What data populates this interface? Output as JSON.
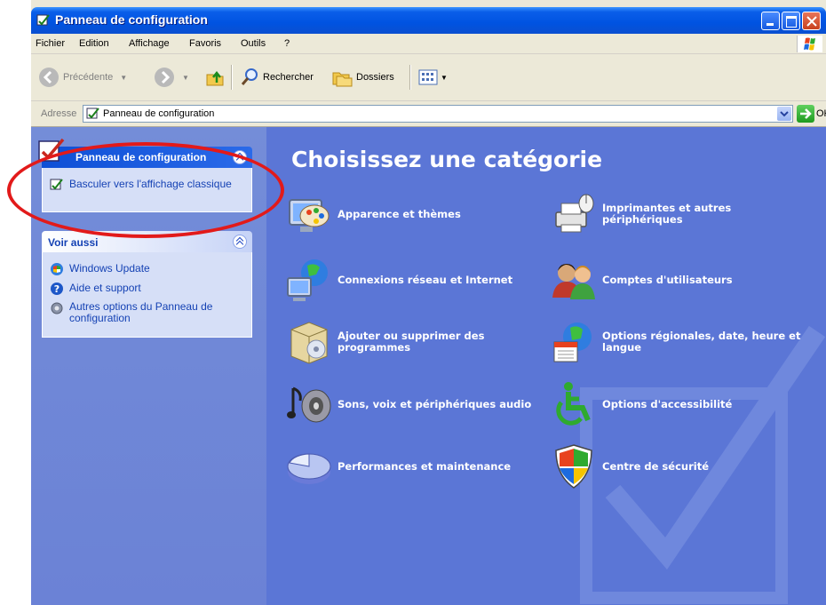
{
  "window": {
    "title": "Panneau de configuration"
  },
  "menubar": {
    "items": [
      "Fichier",
      "Edition",
      "Affichage",
      "Favoris",
      "Outils",
      "?"
    ]
  },
  "toolbar": {
    "back_label": "Précédente",
    "search_label": "Rechercher",
    "folders_label": "Dossiers"
  },
  "address": {
    "label": "Adresse",
    "value": "Panneau de configuration",
    "go_label": "OK"
  },
  "taskpane": {
    "box1": {
      "title": "Panneau de configuration",
      "link": "Basculer vers l'affichage classique"
    },
    "box2": {
      "title": "Voir aussi",
      "links": [
        "Windows Update",
        "Aide et support",
        "Autres options du Panneau de configuration"
      ]
    }
  },
  "main": {
    "heading": "Choisissez une catégorie",
    "categories": [
      "Apparence et thèmes",
      "Imprimantes et autres périphériques",
      "Connexions réseau et Internet",
      "Comptes d'utilisateurs",
      "Ajouter ou supprimer des programmes",
      "Options régionales, date, heure et langue",
      "Sons, voix et périphériques audio",
      "Options d'accessibilité",
      "Performances et maintenance",
      "Centre de sécurité"
    ]
  },
  "colors": {
    "title_bar": "#0053e1",
    "main_bg": "#5b76d6",
    "taskpane_bg": "#748dd8",
    "link": "#1542b4",
    "annotation": "#e21a1a"
  }
}
